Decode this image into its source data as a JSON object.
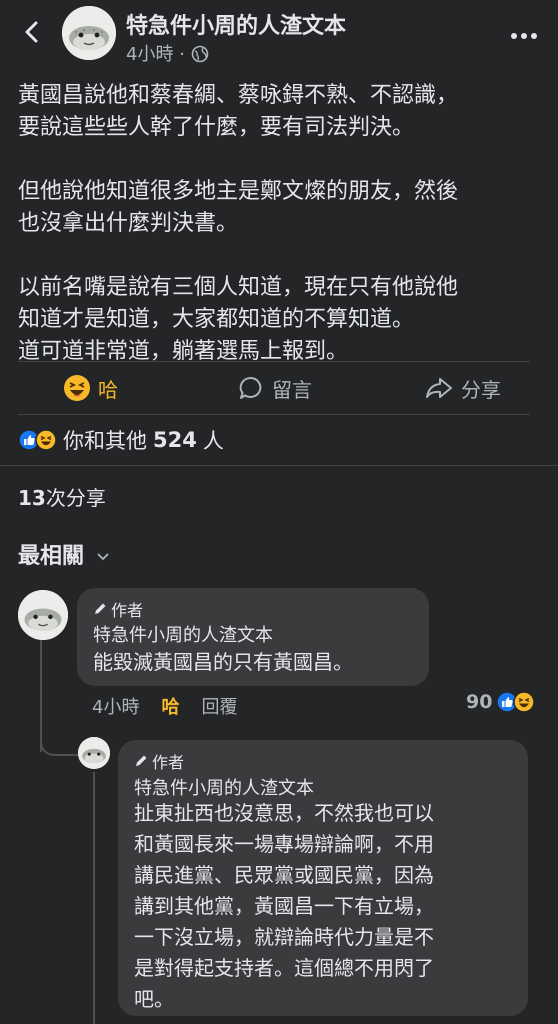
{
  "header": {
    "back_icon": "chevron-left-icon",
    "page_name": "特急件小周的人渣文本",
    "time": "4小時",
    "separator": "·",
    "audience_icon": "globe-icon",
    "more_icon": "more-horizontal-icon"
  },
  "post": {
    "paragraphs": [
      [
        "黃國昌說他和蔡春綢、蔡咏鍀不熟、不認識，",
        "要說這些些人幹了什麼，要有司法判決。"
      ],
      [
        "但他說他知道很多地主是鄭文燦的朋友，然後",
        "也沒拿出什麼判決書。"
      ],
      [
        "以前名嘴是說有三個人知道，現在只有他說他",
        "知道才是知道，大家都知道的不算知道。",
        "道可道非常道，躺著選馬上報到。"
      ]
    ]
  },
  "actions": {
    "haha_label": "哈",
    "comment_label": "留言",
    "share_label": "分享"
  },
  "reactions": {
    "summary_prefix": "你和其他",
    "count": "524",
    "summary_suffix": "人"
  },
  "shares": {
    "count": "13",
    "label": "次分享"
  },
  "sort": {
    "label": "最相關",
    "chevron": "⌄"
  },
  "comments": [
    {
      "author_tag": "作者",
      "name": "特急件小周的人渣文本",
      "text_lines": [
        "能毀滅黃國昌的只有黃國昌。"
      ],
      "time": "4小時",
      "reaction_label": "哈",
      "reply_label": "回覆",
      "reaction_count": "90"
    },
    {
      "author_tag": "作者",
      "name": "特急件小周的人渣文本",
      "text_lines": [
        "扯東扯西也沒意思，不然我也可以",
        "和黃國長來一場專場辯論啊，不用",
        "講民進黨、民眾黨或國民黨，因為",
        "講到其他黨，黃國昌一下有立場，",
        "一下沒立場，就辯論時代力量是不",
        "是對得起支持者。這個總不用閃了",
        "吧。"
      ]
    }
  ],
  "colors": {
    "background": "#242526",
    "bubble": "#3a3b3c",
    "text": "#e4e6eb",
    "secondary_text": "#b0b3b8",
    "haha_yellow": "#f7b928",
    "like_blue": "#1877f2"
  }
}
